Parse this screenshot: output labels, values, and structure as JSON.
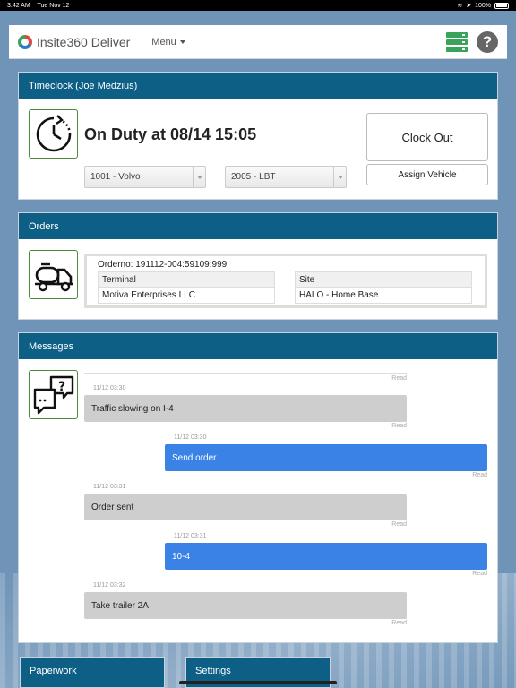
{
  "status_bar": {
    "time": "3:42 AM",
    "date": "Tue Nov 12",
    "battery": "100%"
  },
  "app": {
    "title": "Insite360 Deliver",
    "menu_label": "Menu"
  },
  "icons": {
    "server": "server-status-icon",
    "help": "help-icon",
    "help_glyph": "?"
  },
  "timeclock": {
    "header": "Timeclock (Joe Medzius)",
    "status": "On Duty at 08/14 15:05",
    "vehicle_select": "1001 - Volvo",
    "trailer_select": "2005 - LBT",
    "clock_out_label": "Clock Out",
    "assign_vehicle_label": "Assign Vehicle"
  },
  "orders": {
    "header": "Orders",
    "orderno": "Orderno: 191112-004:59109:999",
    "terminal_header": "Terminal",
    "terminal_value": "Motiva Enterprises LLC",
    "site_header": "Site",
    "site_value": "HALO - Home Base"
  },
  "messages": {
    "header": "Messages",
    "top_read": "Read",
    "items": [
      {
        "direction": "in",
        "time": "11/12 03:30",
        "text": "Traffic slowing on I-4",
        "status": "Read"
      },
      {
        "direction": "out",
        "time": "11/12 03:30",
        "text": "Send order",
        "status": "Read"
      },
      {
        "direction": "in",
        "time": "11/12 03:31",
        "text": "Order sent",
        "status": "Read"
      },
      {
        "direction": "out",
        "time": "11/12 03:31",
        "text": "10-4",
        "status": "Read"
      },
      {
        "direction": "in",
        "time": "11/12 03:32",
        "text": "Take trailer 2A",
        "status": "Read"
      }
    ]
  },
  "bottom_tabs": {
    "paperwork": "Paperwork",
    "settings": "Settings"
  },
  "colors": {
    "header_blue": "#0d5f86",
    "outgoing_bubble": "#3b82e6",
    "incoming_bubble": "#cecece",
    "accent_green": "#3aa35b"
  }
}
